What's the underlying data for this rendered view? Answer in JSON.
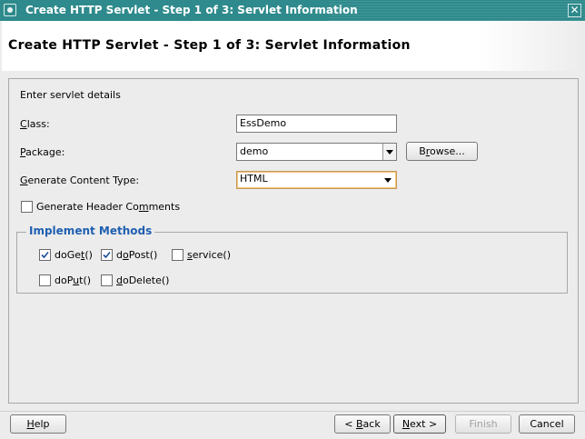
{
  "window": {
    "title": "Create HTTP Servlet - Step 1 of 3: Servlet Information",
    "close_glyph": "✕"
  },
  "header": {
    "title": "Create HTTP Servlet - Step 1 of 3: Servlet Information"
  },
  "form": {
    "intro": "Enter servlet details",
    "class_label": "Class:",
    "class_value": "EssDemo",
    "package_label": "Package:",
    "package_value": "demo",
    "browse_label": "Browse...",
    "content_type_label": "Generate Content Type:",
    "content_type_value": "HTML",
    "header_comments_label": "Generate Header Comments",
    "header_comments_checked": false
  },
  "methods": {
    "legend": "Implement Methods",
    "items": [
      {
        "label": "doGet()",
        "checked": true
      },
      {
        "label": "doPost()",
        "checked": true
      },
      {
        "label": "service()",
        "checked": false
      },
      {
        "label": "doPut()",
        "checked": false
      },
      {
        "label": "doDelete()",
        "checked": false
      }
    ]
  },
  "footer": {
    "help": "Help",
    "back": "< Back",
    "next": "Next >",
    "finish": "Finish",
    "cancel": "Cancel"
  },
  "icons": {
    "window": "servlet-window-icon",
    "close": "close-icon",
    "dropdown": "chevron-down-icon",
    "check": "checkmark-icon"
  },
  "colors": {
    "titlebar": "#2e8a8c",
    "legend": "#1f5fb0",
    "focus_border": "#c29a58"
  }
}
